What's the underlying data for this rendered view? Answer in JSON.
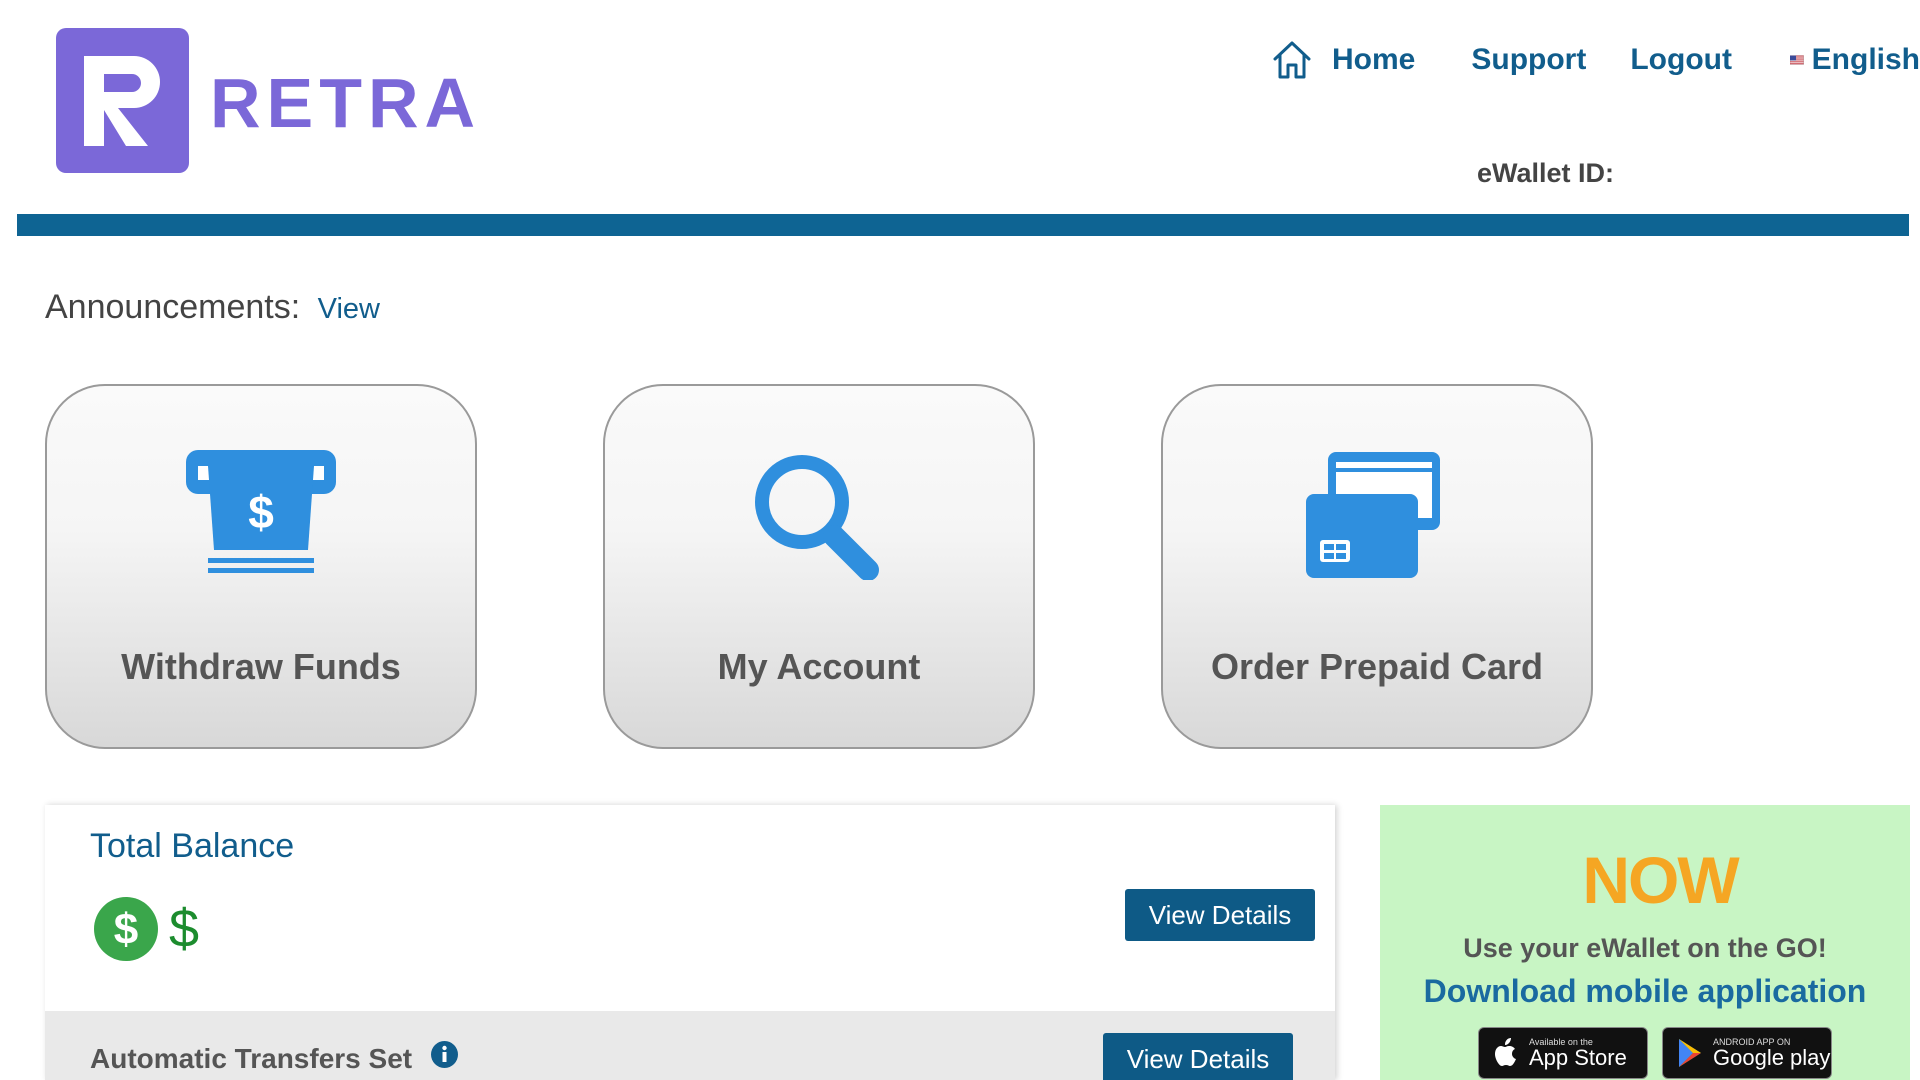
{
  "brand": {
    "logo_letter": "R",
    "logo_word": "RETRA",
    "color": "#7b68d8"
  },
  "nav": {
    "home_label": "Home",
    "support_label": "Support",
    "logout_label": "Logout",
    "language_label": "English",
    "home_icon": "home-icon",
    "flag_icon": "us-flag-icon",
    "link_color": "#115d8c"
  },
  "wallet": {
    "id_label": "eWallet ID:"
  },
  "announcements": {
    "label": "Announcements:",
    "link": "View"
  },
  "tiles": [
    {
      "label": "Withdraw Funds",
      "icon": "atm-cash-icon"
    },
    {
      "label": "My Account",
      "icon": "magnifier-icon"
    },
    {
      "label": "Order Prepaid Card",
      "icon": "credit-cards-icon"
    }
  ],
  "balance": {
    "title": "Total Balance",
    "amount": "$",
    "icon": "dollar-coin-icon",
    "view_details": "View Details"
  },
  "transfers": {
    "label": "Automatic Transfers Set",
    "info_icon": "info-icon",
    "view_details": "View Details"
  },
  "promo": {
    "logo_text": "NOW",
    "tagline": "Use your eWallet on the GO!",
    "link": "Download mobile application",
    "app_store_small": "Available on the",
    "app_store_big": "App Store",
    "google_small": "ANDROID APP ON",
    "google_big": "Google play",
    "background": "#c8f5c4"
  },
  "colors": {
    "accent_bar": "#0e6493",
    "button": "#0e5a86",
    "tile_icon": "#2f8fde"
  }
}
